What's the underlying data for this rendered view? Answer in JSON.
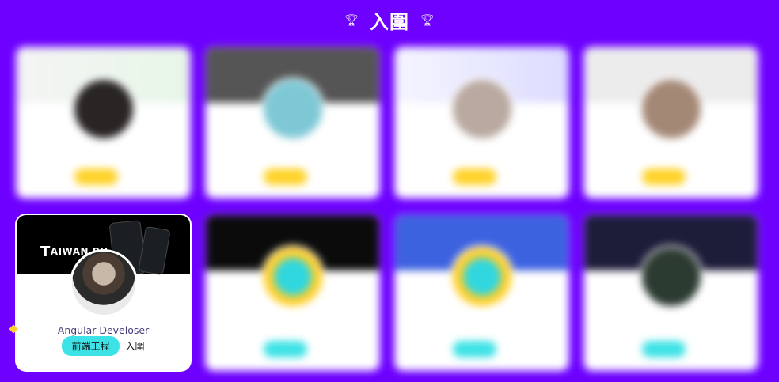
{
  "header": {
    "title": "入圍",
    "icon_left": "trophy-icon",
    "icon_right": "trophy-icon"
  },
  "focused_card": {
    "cover_logo": "AIWAN BU",
    "tagline": "Angular Develoser",
    "chip_label": "前端工程",
    "status_text": "入圍"
  },
  "colors": {
    "background": "#6d00ff",
    "chip_cyan": "#3de2e6",
    "chip_yellow": "#ffd32a"
  }
}
